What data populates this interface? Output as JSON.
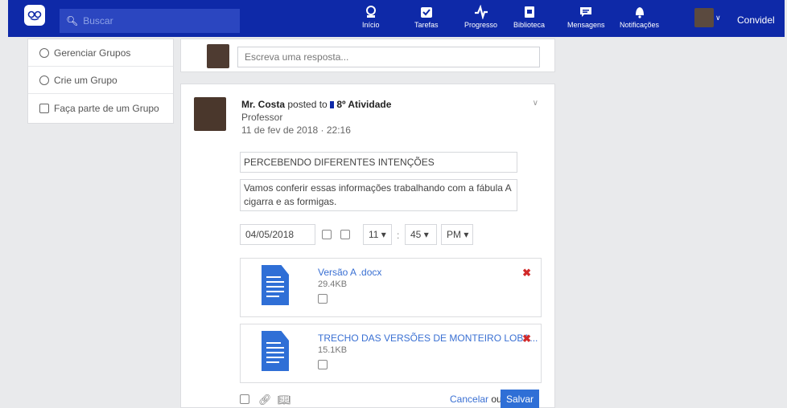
{
  "topbar": {
    "search_placeholder": "Buscar",
    "nav": [
      {
        "label": "Início",
        "icon": "home-icon"
      },
      {
        "label": "Tarefas",
        "icon": "tasks-icon"
      },
      {
        "label": "Progresso",
        "icon": "progress-icon"
      },
      {
        "label": "Biblioteca",
        "icon": "library-icon"
      },
      {
        "label": "Mensagens",
        "icon": "messages-icon"
      },
      {
        "label": "Notificações",
        "icon": "notifications-icon"
      }
    ],
    "user_label": "Convidel"
  },
  "sidebar": {
    "items": [
      {
        "label": "Gerenciar Grupos",
        "icon": "gear-icon"
      },
      {
        "label": "Crie um Grupo",
        "icon": "plus-circle-icon"
      },
      {
        "label": "Faça parte de um Grupo",
        "icon": "group-icon"
      }
    ]
  },
  "reply": {
    "placeholder": "Escreva uma resposta..."
  },
  "post": {
    "author": "Mr. Costa",
    "posted_to": "posted to",
    "group": "8º Atividade",
    "role": "Professor",
    "date": "11 de fev de 2018 · 22:16",
    "title": "PERCEBENDO DIFERENTES INTENÇÕES",
    "body": "Vamos conferir essas informações trabalhando com a fábula A cigarra e as formigas.",
    "due_date": "04/05/2018",
    "hour": "11",
    "minute": "45",
    "ampm": "PM",
    "colon": ":",
    "attachments": [
      {
        "name": "Versão A .docx",
        "size": "29.4KB"
      },
      {
        "name": "TRECHO DAS VERSÕES DE MONTEIRO LOBA...",
        "size": "15.1KB"
      }
    ],
    "cancel_label": "Cancelar",
    "or_label": "ou",
    "save_label": "Salvar"
  },
  "colors": {
    "topbar": "#0e29a8",
    "accent": "#2f6fd6",
    "remove": "#d12a2a"
  }
}
